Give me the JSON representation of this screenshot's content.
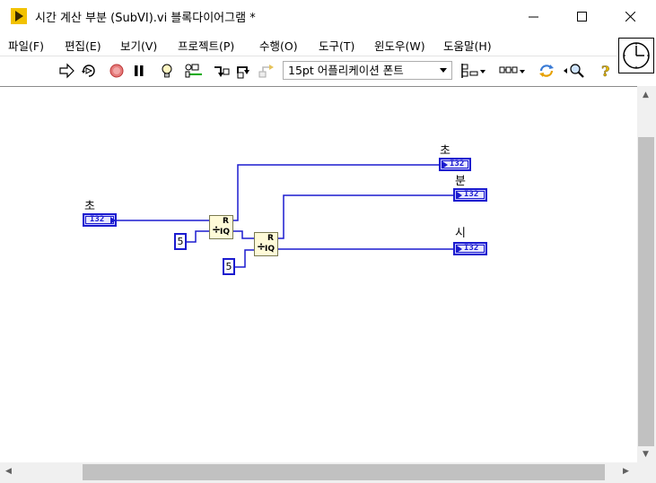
{
  "window": {
    "title": "시간 계산 부분 (SubVI).vi 블록다이어그램 *"
  },
  "menu": {
    "items": [
      "파일(F)",
      "편집(E)",
      "보기(V)",
      "프로젝트(P)",
      "수행(O)",
      "도구(T)",
      "윈도우(W)",
      "도움말(H)"
    ]
  },
  "toolbar": {
    "font_select": "15pt 어플리케이션 폰트"
  },
  "diagram": {
    "input_label": "초",
    "input_type": "I32",
    "const_1": "5",
    "const_2": "5",
    "outputs": [
      {
        "label": "초",
        "type": "I32"
      },
      {
        "label": "분",
        "type": "I32"
      },
      {
        "label": "시",
        "type": "I32"
      }
    ],
    "node_symbol": "÷",
    "node_r": "R",
    "node_iq": "IQ"
  },
  "colors": {
    "wire": "#1b1bcf",
    "node_fill": "#fffbd8",
    "terminal_fill": "#c8c8ff"
  }
}
